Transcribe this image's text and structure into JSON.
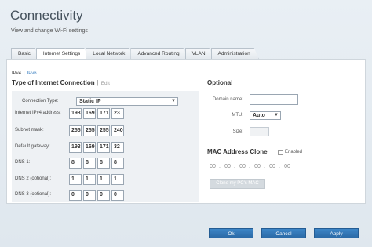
{
  "header": {
    "title": "Connectivity",
    "subtitle": "View and change Wi-Fi settings"
  },
  "tabs": [
    "Basic",
    "Internet Settings",
    "Local Network",
    "Advanced Routing",
    "VLAN",
    "Administration"
  ],
  "active_tab": "Internet Settings",
  "subtabs": {
    "ipv4": "IPv4",
    "separator": "|",
    "ipv6": "IPv6"
  },
  "connection": {
    "title": "Type of Internet Connection",
    "separator": "|",
    "edit_label": "Edit",
    "type_label": "Connection Type:",
    "type_value": "Static IP",
    "fields": [
      {
        "label": "Internet IPv4 address:",
        "octets": [
          "193",
          "169",
          "171",
          "23"
        ]
      },
      {
        "label": "Subnet mask:",
        "octets": [
          "255",
          "255",
          "255",
          "240"
        ]
      },
      {
        "label": "Default gateway:",
        "octets": [
          "193",
          "169",
          "171",
          "32"
        ]
      },
      {
        "label": "DNS 1:",
        "octets": [
          "8",
          "8",
          "8",
          "8"
        ]
      },
      {
        "label": "DNS 2 (optional):",
        "octets": [
          "1",
          "1",
          "1",
          "1"
        ]
      },
      {
        "label": "DNS 3 (optional):",
        "octets": [
          "0",
          "0",
          "0",
          "0"
        ]
      }
    ]
  },
  "optional": {
    "title": "Optional",
    "domain_label": "Domain name:",
    "domain_value": "",
    "mtu_label": "MTU:",
    "mtu_value": "Auto",
    "size_label": "Size:",
    "size_value": ""
  },
  "mac_clone": {
    "title": "MAC Address Clone",
    "enabled_label": "Enabled",
    "enabled": false,
    "octets": [
      "00",
      "00",
      "00",
      "00",
      "00",
      "00"
    ],
    "clone_button": "Clone my PC's MAC"
  },
  "footer": {
    "ok": "Ok",
    "cancel": "Cancel",
    "apply": "Apply"
  }
}
